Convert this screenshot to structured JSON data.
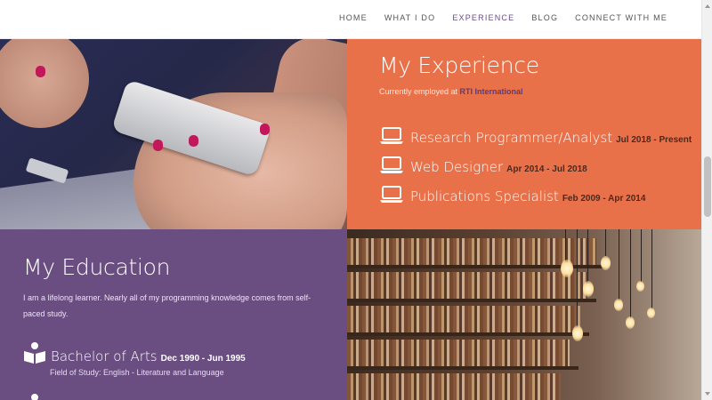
{
  "nav": {
    "items": [
      {
        "label": "HOME",
        "active": false
      },
      {
        "label": "WHAT I DO",
        "active": false
      },
      {
        "label": "EXPERIENCE",
        "active": true
      },
      {
        "label": "BLOG",
        "active": false
      },
      {
        "label": "CONNECT WITH ME",
        "active": false
      }
    ]
  },
  "experience": {
    "title": "My Experience",
    "employed_prefix": "Currently employed at ",
    "employer": "RTI International",
    "items": [
      {
        "role": "Research Programmer/Analyst",
        "dates": "Jul 2018 - Present",
        "icon": "laptop-icon"
      },
      {
        "role": "Web Designer",
        "dates": "Apr 2014 - Jul 2018",
        "icon": "laptop-icon"
      },
      {
        "role": "Publications Specialist",
        "dates": "Feb 2009 - Apr 2014",
        "icon": "laptop-icon"
      }
    ]
  },
  "education": {
    "title": "My Education",
    "intro": "I am a lifelong learner. Nearly all of my programming knowledge comes from self-paced study.",
    "items": [
      {
        "degree": "Bachelor of Arts",
        "dates": "Dec 1990 - Jun 1995",
        "field": "Field of Study: English - Literature and Language",
        "icon": "reader-icon"
      }
    ]
  },
  "colors": {
    "experience_bg": "#e8714a",
    "education_bg": "#6a4e81",
    "nav_active": "#6b4a8a"
  }
}
